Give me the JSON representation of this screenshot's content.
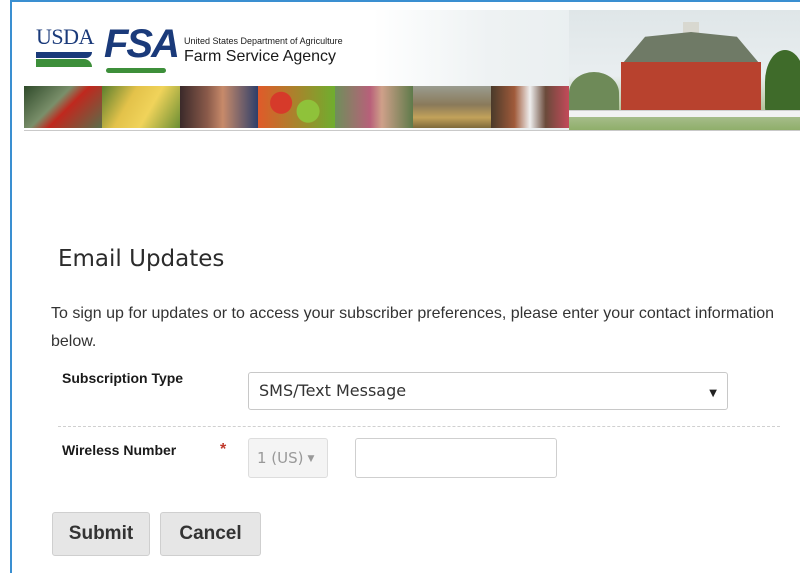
{
  "header": {
    "usda_logo_text": "USDA",
    "fsa_logo_text": "FSA",
    "department": "United States Department of Agriculture",
    "agency": "Farm Service Agency",
    "photo_strip": [
      "cardinal-photo",
      "corn-photo",
      "children-eating-photo",
      "vegetables-photo",
      "farm-worker-photo",
      "harvest-photo",
      "cattle-photo"
    ],
    "hero_image": "red-barn-photo"
  },
  "main": {
    "title": "Email Updates",
    "intro": "To sign up for updates or to access your subscriber preferences, please enter your contact information below.",
    "subscription_type": {
      "label": "Subscription Type",
      "value": "SMS/Text Message"
    },
    "wireless_number": {
      "label": "Wireless Number",
      "required_marker": "*",
      "country_code": "1 (US)",
      "phone_value": ""
    },
    "buttons": {
      "submit": "Submit",
      "cancel": "Cancel"
    }
  },
  "colors": {
    "usda_blue": "#1a3a7a",
    "usda_green": "#3d8f3a",
    "frame_border": "#3a8fd1",
    "required_red": "#c0392b"
  }
}
